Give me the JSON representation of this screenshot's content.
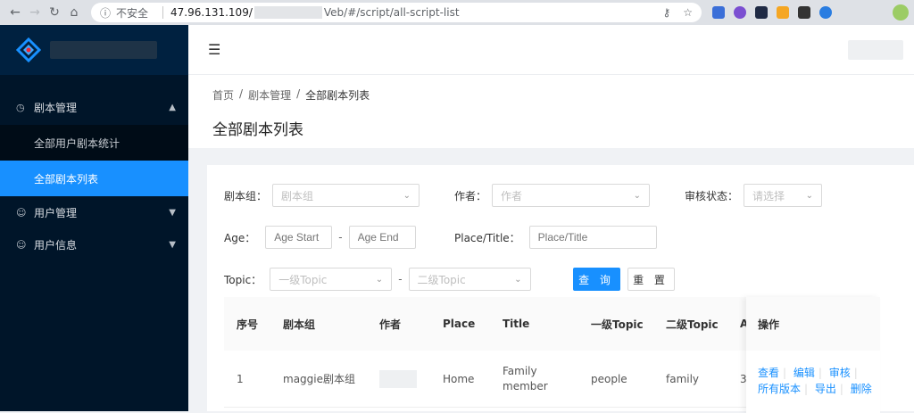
{
  "browser": {
    "insecure_label": "不安全",
    "host": "47.96.131.109/",
    "path": "Veb/#/script/all-script-list",
    "ext_colors": [
      "#3b6fd8",
      "#7b4fd1",
      "#1f2a44",
      "#f5a623",
      "#333333",
      "#2a7de1"
    ]
  },
  "sidebar": {
    "menus": [
      {
        "label": "剧本管理",
        "icon": "dashboard-icon",
        "expanded": true,
        "children": [
          {
            "label": "全部用户剧本统计"
          },
          {
            "label": "全部剧本列表",
            "active": true
          }
        ]
      },
      {
        "label": "用户管理",
        "icon": "user-icon",
        "expanded": false
      },
      {
        "label": "用户信息",
        "icon": "user-icon",
        "expanded": false
      }
    ]
  },
  "breadcrumb": {
    "home": "首页",
    "sep": "/",
    "level2": "剧本管理",
    "current": "全部剧本列表"
  },
  "page_title": "全部剧本列表",
  "filters": {
    "group": {
      "label": "剧本组：",
      "placeholder": "剧本组"
    },
    "author": {
      "label": "作者：",
      "placeholder": "作者"
    },
    "review": {
      "label": "审核状态：",
      "placeholder": "请选择"
    },
    "age": {
      "label": "Age：",
      "start_placeholder": "Age Start",
      "end_placeholder": "Age End"
    },
    "place": {
      "label": "Place/Title：",
      "placeholder": "Place/Title"
    },
    "topic": {
      "label": "Topic：",
      "first_placeholder": "一级Topic",
      "second_placeholder": "二级Topic"
    },
    "dash": "-",
    "query_label": "查 询",
    "reset_label": "重 置"
  },
  "table": {
    "headers": [
      "序号",
      "剧本组",
      "作者",
      "Place",
      "Title",
      "一级Topic",
      "二级Topic",
      "A",
      "操作"
    ],
    "rows": [
      {
        "index": "1",
        "group": "maggie剧本组",
        "place": "Home",
        "title_line1": "Family",
        "title_line2": "member",
        "topic1": "people",
        "topic2": "family",
        "age": "3"
      }
    ],
    "actions": {
      "view": "查看",
      "edit": "编辑",
      "review": "审核",
      "all_versions": "所有版本",
      "export": "导出",
      "delete": "删除"
    }
  },
  "colors": {
    "sidebar_bg": "#001529",
    "accent": "#1890ff"
  }
}
